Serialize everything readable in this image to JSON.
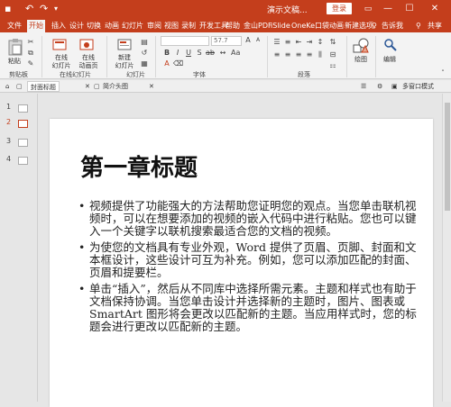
{
  "titlebar": {
    "title": "演示文稿...",
    "login": "登录",
    "restore_icon": "ribbon-display-icon",
    "min": "—",
    "max": "☐",
    "close": "✕"
  },
  "tabs": [
    "文件",
    "开始",
    "插入",
    "设计",
    "切换",
    "动画",
    "幻灯片",
    "审阅",
    "视图",
    "录制",
    "开发工具",
    "帮助",
    "金山PDF",
    "iSlide",
    "OneKe",
    "口袋动画",
    "新建选项"
  ],
  "active_tab": "开始",
  "tellme": "告诉我",
  "share": "共享",
  "ribbon": {
    "paste": "粘贴",
    "clipboard_label": "剪贴板",
    "online_slide": "在线\n幻灯片",
    "online_anim": "在线\n动画页",
    "new_slide": "新建\n幻灯片",
    "slides_label": "在线幻灯片",
    "slides_group_label": "幻灯片",
    "font_size": "57.7",
    "font_label": "字体",
    "para_label": "段落",
    "draw": "绘图",
    "edit": "编辑"
  },
  "doctabs": {
    "tab1": "封面标题",
    "tab2": "简介头图",
    "right_label": "多窗口模式"
  },
  "thumbnails": [
    {
      "num": "1"
    },
    {
      "num": "2"
    },
    {
      "num": "3"
    },
    {
      "num": "4"
    }
  ],
  "slide": {
    "title": "第一章标题",
    "bullets": [
      "视频提供了功能强大的方法帮助您证明您的观点。当您单击联机视频时，可以在想要添加的视频的嵌入代码中进行粘贴。您也可以键入一个关键字以联机搜索最适合您的文档的视频。",
      "为使您的文档具有专业外观，Word 提供了页眉、页脚、封面和文本框设计，这些设计可互为补充。例如，您可以添加匹配的封面、页眉和提要栏。",
      "单击“插入”，然后从不同库中选择所需元素。主题和样式也有助于文档保持协调。当您单击设计并选择新的主题时，图片、图表或 SmartArt 图形将会更改以匹配新的主题。当应用样式时，您的标题会进行更改以匹配新的主题。"
    ]
  },
  "colors": {
    "accent": "#c43e1c"
  }
}
